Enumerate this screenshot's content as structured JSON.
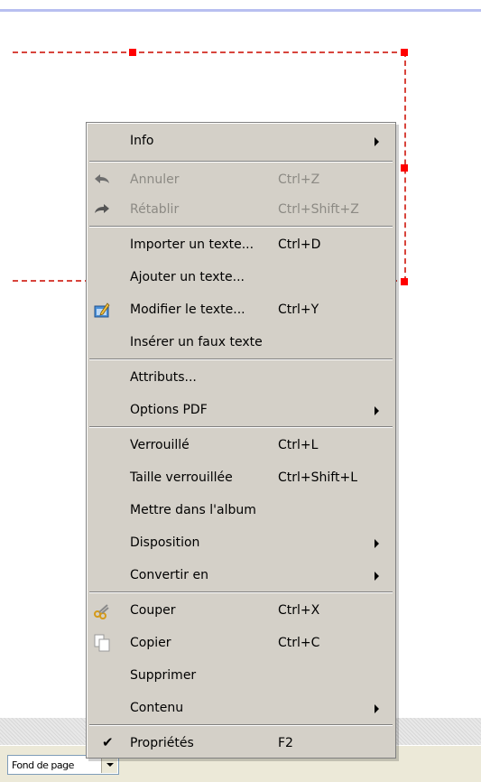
{
  "status_bar": {
    "page_combo_value": "Fond de page"
  },
  "menu": {
    "items": [
      {
        "label": "Info",
        "shortcut": "",
        "submenu": true,
        "disabled": false,
        "icon": ""
      },
      {
        "label": "Annuler",
        "shortcut": "Ctrl+Z",
        "submenu": false,
        "disabled": true,
        "icon": "undo-icon"
      },
      {
        "label": "Rétablir",
        "shortcut": "Ctrl+Shift+Z",
        "submenu": false,
        "disabled": true,
        "icon": "redo-icon"
      },
      {
        "label": "Importer un texte...",
        "shortcut": "Ctrl+D",
        "submenu": false,
        "disabled": false,
        "icon": ""
      },
      {
        "label": "Ajouter un texte...",
        "shortcut": "",
        "submenu": false,
        "disabled": false,
        "icon": ""
      },
      {
        "label": "Modifier le texte...",
        "shortcut": "Ctrl+Y",
        "submenu": false,
        "disabled": false,
        "icon": "edit-text-icon"
      },
      {
        "label": "Insérer un faux texte",
        "shortcut": "",
        "submenu": false,
        "disabled": false,
        "icon": ""
      },
      {
        "label": "Attributs...",
        "shortcut": "",
        "submenu": false,
        "disabled": false,
        "icon": ""
      },
      {
        "label": "Options PDF",
        "shortcut": "",
        "submenu": true,
        "disabled": false,
        "icon": ""
      },
      {
        "label": "Verrouillé",
        "shortcut": "Ctrl+L",
        "submenu": false,
        "disabled": false,
        "icon": ""
      },
      {
        "label": "Taille verrouillée",
        "shortcut": "Ctrl+Shift+L",
        "submenu": false,
        "disabled": false,
        "icon": ""
      },
      {
        "label": "Mettre dans l'album",
        "shortcut": "",
        "submenu": false,
        "disabled": false,
        "icon": ""
      },
      {
        "label": "Disposition",
        "shortcut": "",
        "submenu": true,
        "disabled": false,
        "icon": ""
      },
      {
        "label": "Convertir en",
        "shortcut": "",
        "submenu": true,
        "disabled": false,
        "icon": ""
      },
      {
        "label": "Couper",
        "shortcut": "Ctrl+X",
        "submenu": false,
        "disabled": false,
        "icon": "scissors-icon"
      },
      {
        "label": "Copier",
        "shortcut": "Ctrl+C",
        "submenu": false,
        "disabled": false,
        "icon": "copy-icon"
      },
      {
        "label": "Supprimer",
        "shortcut": "",
        "submenu": false,
        "disabled": false,
        "icon": ""
      },
      {
        "label": "Contenu",
        "shortcut": "",
        "submenu": true,
        "disabled": false,
        "icon": ""
      },
      {
        "label": "Propriétés",
        "shortcut": "F2",
        "submenu": false,
        "disabled": false,
        "icon": "checkmark-icon",
        "checked": true
      }
    ]
  },
  "colors": {
    "menu_background": "#d4d0c8",
    "selection_frame": "#d8443c",
    "handle": "#ff0000",
    "disabled_text": "#8c8a84"
  }
}
